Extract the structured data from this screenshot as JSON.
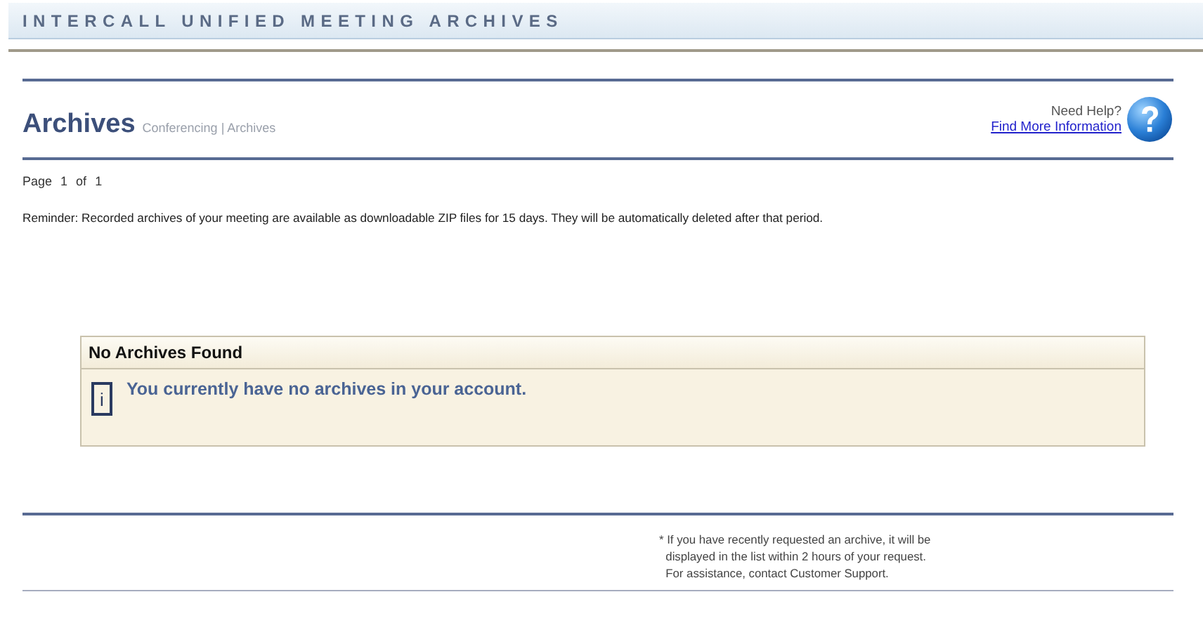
{
  "banner": {
    "title": "INTERCALL UNIFIED MEETING ARCHIVES"
  },
  "header": {
    "title": "Archives",
    "breadcrumb": "Conferencing | Archives",
    "help_label": "Need Help?",
    "help_link": "Find More Information"
  },
  "pager": {
    "label": "Page",
    "current": "1",
    "of": "of",
    "total": "1"
  },
  "reminder": "Reminder: Recorded archives of your meeting are available as downloadable ZIP files for 15 days. They will be automatically deleted after that period.",
  "notice": {
    "title": "No Archives Found",
    "icon": "i",
    "message": "You currently have no archives in your account."
  },
  "footnote": [
    "* If you have recently requested an archive, it will be",
    "displayed in the list within 2 hours of your request.",
    "For assistance, contact Customer Support."
  ]
}
